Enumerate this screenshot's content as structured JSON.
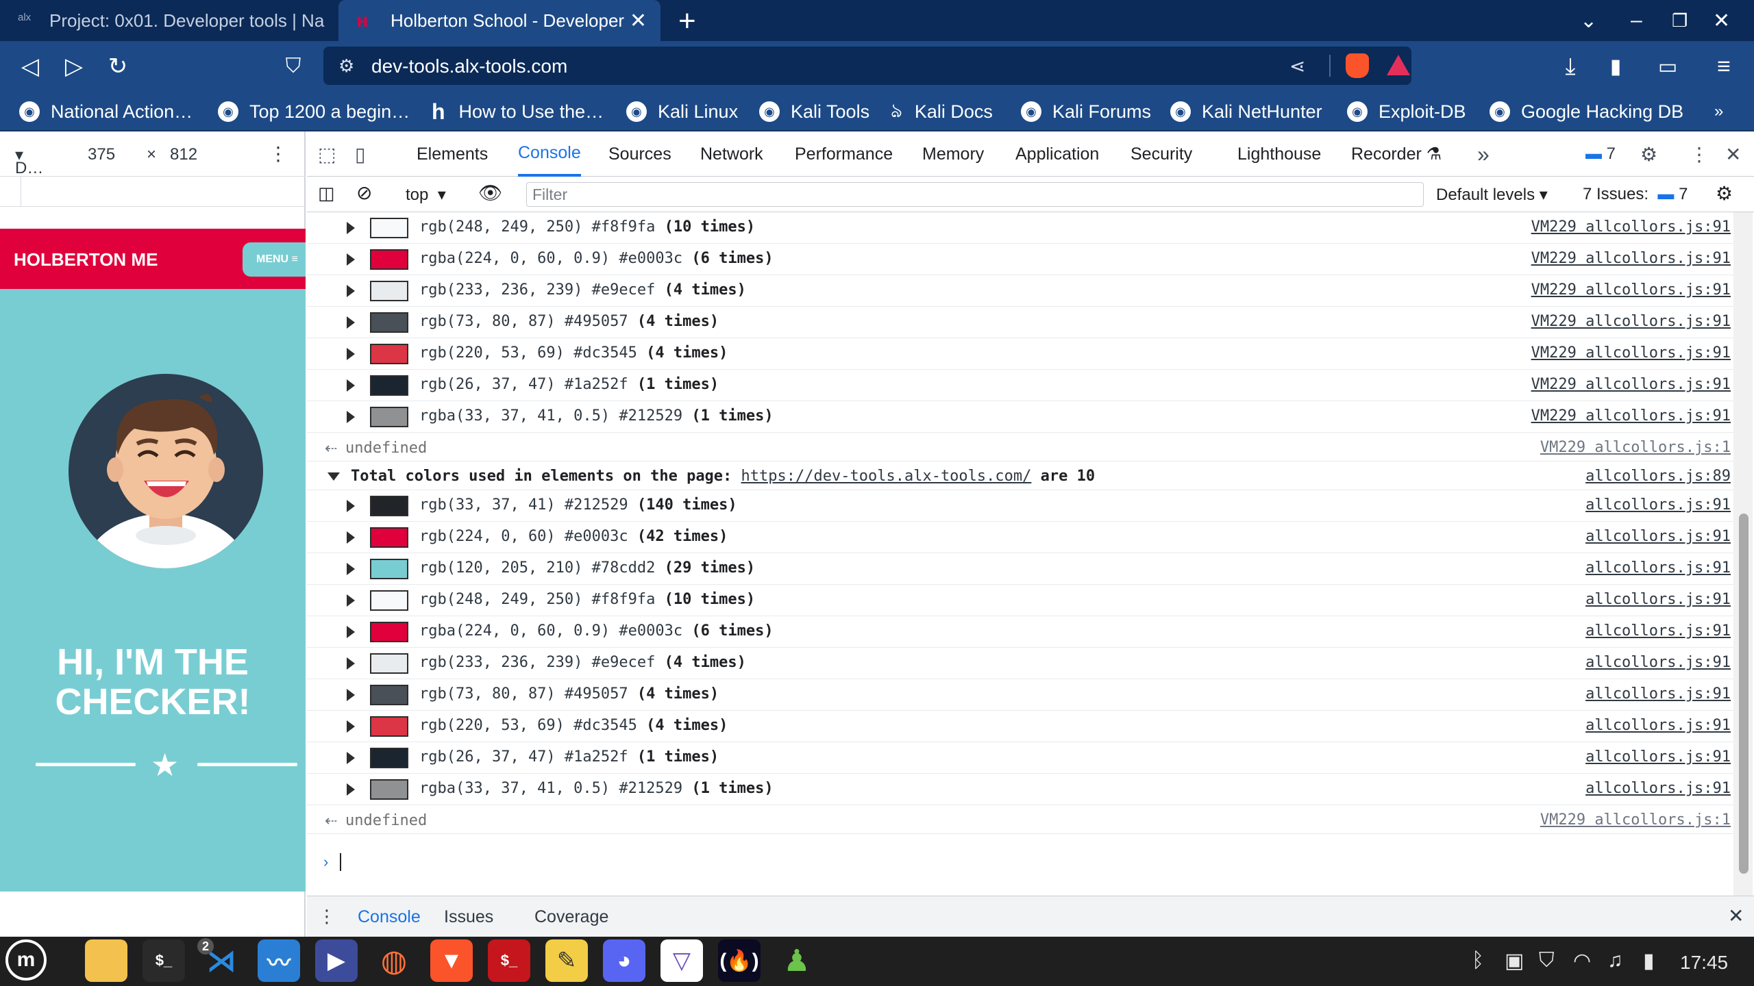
{
  "browser": {
    "tabs": [
      {
        "title": "Project: 0x01. Developer tools | Na",
        "favicon": "alx"
      },
      {
        "title": "Holberton School - Developer",
        "close": "✕"
      }
    ],
    "new_tab": "+",
    "address": "dev-tools.alx-tools.com",
    "bookmarks": [
      {
        "label": "National Action…"
      },
      {
        "label": "Top 1200 a begin…"
      },
      {
        "label": "How to Use the…"
      },
      {
        "label": "Kali Linux"
      },
      {
        "label": "Kali Tools"
      },
      {
        "label": "Kali Docs"
      },
      {
        "label": "Kali Forums"
      },
      {
        "label": "Kali NetHunter"
      },
      {
        "label": "Exploit-DB"
      },
      {
        "label": "Google Hacking DB"
      }
    ]
  },
  "device_toolbar": {
    "device": "D…",
    "width": "375",
    "times": "×",
    "height": "812"
  },
  "site": {
    "logo": "HOLBERTON ME",
    "menu": "MENU",
    "hero_line1": "HI, I'M THE",
    "hero_line2": "CHECKER!"
  },
  "devtools": {
    "tabs": [
      "Elements",
      "Console",
      "Sources",
      "Network",
      "Performance",
      "Memory",
      "Application",
      "Security",
      "Lighthouse",
      "Recorder"
    ],
    "active_tab": "Console",
    "messages_badge": "7",
    "context": "top",
    "filter_placeholder": "Filter",
    "levels": "Default levels",
    "issues_label": "7 Issues:",
    "issues_count": "7",
    "drawer_tabs": [
      "Console",
      "Issues",
      "Coverage"
    ]
  },
  "console": {
    "group1_rows": [
      {
        "swatch": "#f8f9fa",
        "text": "rgb(248, 249, 250) #f8f9fa ",
        "count": "(10 times)",
        "source": "VM229 allcollors.js:91"
      },
      {
        "swatch": "#e0003c",
        "text": "rgba(224, 0, 60, 0.9) #e0003c ",
        "count": "(6 times)",
        "source": "VM229 allcollors.js:91"
      },
      {
        "swatch": "#e9ecef",
        "text": "rgb(233, 236, 239) #e9ecef ",
        "count": "(4 times)",
        "source": "VM229 allcollors.js:91"
      },
      {
        "swatch": "#495057",
        "text": "rgb(73, 80, 87) #495057 ",
        "count": "(4 times)",
        "source": "VM229 allcollors.js:91"
      },
      {
        "swatch": "#dc3545",
        "text": "rgb(220, 53, 69) #dc3545 ",
        "count": "(4 times)",
        "source": "VM229 allcollors.js:91"
      },
      {
        "swatch": "#1a252f",
        "text": "rgb(26, 37, 47) #1a252f ",
        "count": "(1 times)",
        "source": "VM229 allcollors.js:91"
      },
      {
        "swatch": "#909192",
        "text": "rgba(33, 37, 41, 0.5) #212529 ",
        "count": "(1 times)",
        "source": "VM229 allcollors.js:91"
      }
    ],
    "undefined_1": {
      "text": "undefined",
      "source": "VM229 allcollors.js:1"
    },
    "group2_header": {
      "prefix": "Total colors used in elements on the page: ",
      "link": "https://dev-tools.alx-tools.com/",
      "suffix": " are 10",
      "source": "allcollors.js:89"
    },
    "group2_rows": [
      {
        "swatch": "#212529",
        "text": "rgb(33, 37, 41) #212529 ",
        "count": "(140 times)",
        "source": "allcollors.js:91"
      },
      {
        "swatch": "#e0003c",
        "text": "rgb(224, 0, 60) #e0003c ",
        "count": "(42 times)",
        "source": "allcollors.js:91"
      },
      {
        "swatch": "#78cdd2",
        "text": "rgb(120, 205, 210) #78cdd2 ",
        "count": "(29 times)",
        "source": "allcollors.js:91"
      },
      {
        "swatch": "#f8f9fa",
        "text": "rgb(248, 249, 250) #f8f9fa ",
        "count": "(10 times)",
        "source": "allcollors.js:91"
      },
      {
        "swatch": "#e0003c",
        "text": "rgba(224, 0, 60, 0.9) #e0003c ",
        "count": "(6 times)",
        "source": "allcollors.js:91"
      },
      {
        "swatch": "#e9ecef",
        "text": "rgb(233, 236, 239) #e9ecef ",
        "count": "(4 times)",
        "source": "allcollors.js:91"
      },
      {
        "swatch": "#495057",
        "text": "rgb(73, 80, 87) #495057 ",
        "count": "(4 times)",
        "source": "allcollors.js:91"
      },
      {
        "swatch": "#dc3545",
        "text": "rgb(220, 53, 69) #dc3545 ",
        "count": "(4 times)",
        "source": "allcollors.js:91"
      },
      {
        "swatch": "#1a252f",
        "text": "rgb(26, 37, 47) #1a252f ",
        "count": "(1 times)",
        "source": "allcollors.js:91"
      },
      {
        "swatch": "#909192",
        "text": "rgba(33, 37, 41, 0.5) #212529 ",
        "count": "(1 times)",
        "source": "allcollors.js:91"
      }
    ],
    "undefined_2": {
      "text": "undefined",
      "source": "VM229 allcollors.js:1"
    }
  },
  "taskbar": {
    "vscode_badge": "2",
    "clock": "17:45"
  }
}
